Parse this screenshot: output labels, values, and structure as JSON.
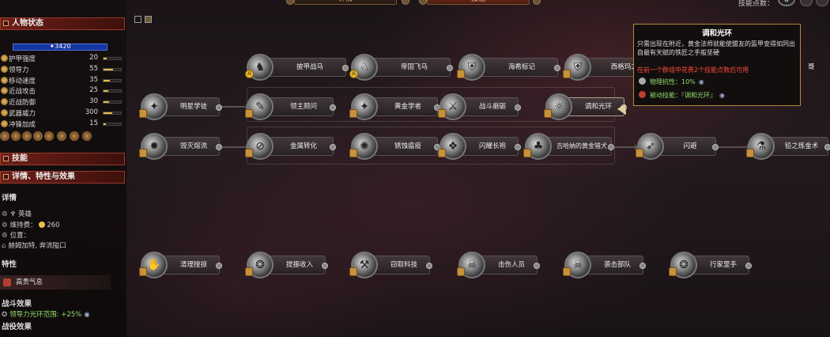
{
  "top": {
    "tab_left": "详情",
    "tab_right": "技能",
    "skill_points_label": "技能点数：",
    "skill_points_value": "0"
  },
  "left": {
    "character_status_title": "人物状态",
    "hp": "3420",
    "hp_fraction": 1.0,
    "stats": [
      {
        "label": "护甲强度",
        "value": "20",
        "fill": 0.2
      },
      {
        "label": "领导力",
        "value": "55",
        "fill": 0.55
      },
      {
        "label": "移动速度",
        "value": "35",
        "fill": 0.35
      },
      {
        "label": "近战攻击",
        "value": "25",
        "fill": 0.25
      },
      {
        "label": "近战防御",
        "value": "30",
        "fill": 0.3
      },
      {
        "label": "武器威力",
        "value": "300",
        "fill": 0.5
      },
      {
        "label": "冲锋加成",
        "value": "15",
        "fill": 0.15
      }
    ],
    "skills_section_title": "技能",
    "details_section_title": "详情、特性与效果",
    "details_title": "详情",
    "unit_type": "英雄",
    "upkeep_label": "维持费：",
    "upkeep_value": "260",
    "location_label": "位置：",
    "location_value": "赫姆加特, 奔流隘口",
    "traits_title": "特性",
    "trait_name": "高贵气息",
    "battle_effects_title": "战斗效果",
    "battle_effect": "领导力光环范围: +25%",
    "campaign_effects_title": "战役效果"
  },
  "tree": {
    "row1": [
      {
        "label": "披甲战马",
        "glyph": "♞"
      },
      {
        "label": "帝国飞马",
        "glyph": "♘"
      },
      {
        "label": "海希标记",
        "glyph": "⛨"
      },
      {
        "label": "西格玛之焰",
        "glyph": "⛨"
      }
    ],
    "row2": [
      {
        "label": "明星学徒",
        "glyph": "✦"
      },
      {
        "label": "领主顾问",
        "glyph": "✎"
      },
      {
        "label": "黄金学者",
        "glyph": "✦"
      },
      {
        "label": "战斗磨砺",
        "glyph": "⚔"
      },
      {
        "label": "调和光环",
        "glyph": "☼"
      }
    ],
    "row3": [
      {
        "label": "毁灭熔流",
        "glyph": "✹"
      },
      {
        "label": "金属转化",
        "glyph": "⊘"
      },
      {
        "label": "锈蚀瘟疫",
        "glyph": "✺"
      },
      {
        "label": "闪耀长袍",
        "glyph": "❖"
      },
      {
        "label": "吉哈纳的黄金猎犬",
        "glyph": "♣"
      },
      {
        "label": "闪避",
        "glyph": "➶"
      },
      {
        "label": "铅之炼金术",
        "glyph": "⚗"
      }
    ],
    "row4": [
      {
        "label": "清理搜掠",
        "glyph": "✋"
      },
      {
        "label": "提振收入",
        "glyph": "❂"
      },
      {
        "label": "窃取科技",
        "glyph": "⚒"
      },
      {
        "label": "击伤人员",
        "glyph": "☠"
      },
      {
        "label": "袭击部队",
        "glyph": "☠"
      },
      {
        "label": "行家里手",
        "glyph": "❂"
      }
    ],
    "partial_label": "哥"
  },
  "tooltip": {
    "title": "调和光环",
    "description": "只需出现在附近，黄金法师就能使盟友的盔甲变得如同出自最有天赋的铁匠之手般坚硬",
    "requirement": "在前一个群组中花费2个技能点数后可用",
    "effect_1": "物理抗性：10%",
    "effect_2": "被动技能：『调和光环』"
  }
}
